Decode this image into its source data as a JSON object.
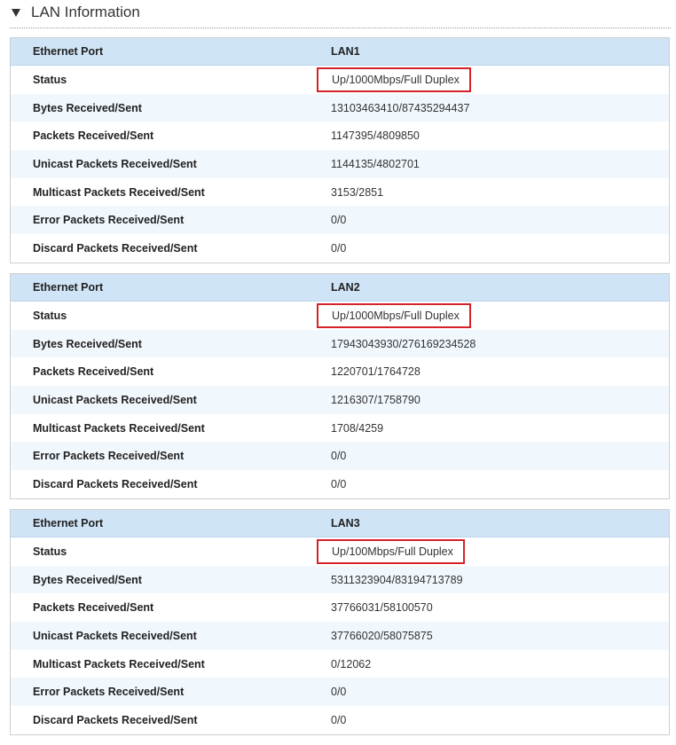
{
  "section": {
    "title": "LAN Information",
    "collapse_icon": "triangle-down-icon"
  },
  "tables": [
    {
      "rows": [
        {
          "label": "Ethernet Port",
          "value": "LAN1"
        },
        {
          "label": "Status",
          "value": "Up/1000Mbps/Full Duplex"
        },
        {
          "label": "Bytes Received/Sent",
          "value": "13103463410/87435294437"
        },
        {
          "label": "Packets Received/Sent",
          "value": "1147395/4809850"
        },
        {
          "label": "Unicast Packets Received/Sent",
          "value": "1144135/4802701"
        },
        {
          "label": "Multicast Packets Received/Sent",
          "value": "3153/2851"
        },
        {
          "label": "Error Packets Received/Sent",
          "value": "0/0"
        },
        {
          "label": "Discard Packets Received/Sent",
          "value": "0/0"
        }
      ]
    },
    {
      "rows": [
        {
          "label": "Ethernet Port",
          "value": "LAN2"
        },
        {
          "label": "Status",
          "value": "Up/1000Mbps/Full Duplex"
        },
        {
          "label": "Bytes Received/Sent",
          "value": "17943043930/276169234528"
        },
        {
          "label": "Packets Received/Sent",
          "value": "1220701/1764728"
        },
        {
          "label": "Unicast Packets Received/Sent",
          "value": "1216307/1758790"
        },
        {
          "label": "Multicast Packets Received/Sent",
          "value": "1708/4259"
        },
        {
          "label": "Error Packets Received/Sent",
          "value": "0/0"
        },
        {
          "label": "Discard Packets Received/Sent",
          "value": "0/0"
        }
      ]
    },
    {
      "rows": [
        {
          "label": "Ethernet Port",
          "value": "LAN3"
        },
        {
          "label": "Status",
          "value": "Up/100Mbps/Full Duplex"
        },
        {
          "label": "Bytes Received/Sent",
          "value": "5311323904/83194713789"
        },
        {
          "label": "Packets Received/Sent",
          "value": "37766031/58100570"
        },
        {
          "label": "Unicast Packets Received/Sent",
          "value": "37766020/58075875"
        },
        {
          "label": "Multicast Packets Received/Sent",
          "value": "0/12062"
        },
        {
          "label": "Error Packets Received/Sent",
          "value": "0/0"
        },
        {
          "label": "Discard Packets Received/Sent",
          "value": "0/0"
        }
      ]
    }
  ],
  "colors": {
    "header_row_bg": "#cfe4f6",
    "shaded_row_bg": "#f0f7fd",
    "highlight_border": "#d42229",
    "table_border": "#cfcfcf"
  }
}
